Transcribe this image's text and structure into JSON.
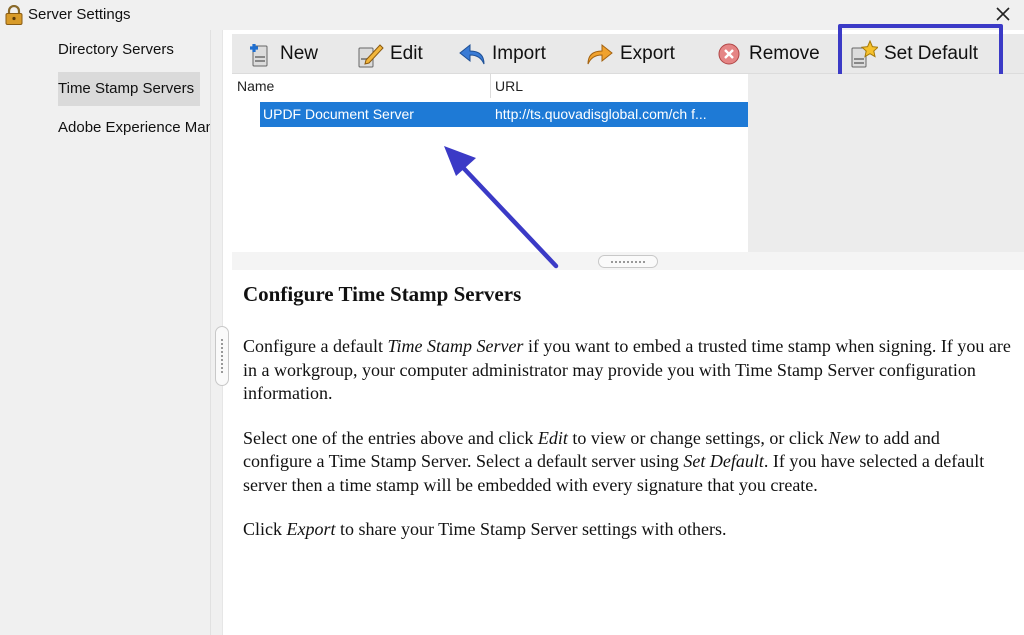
{
  "window": {
    "title": "Server Settings",
    "title_icon": "lock-icon",
    "close_icon": "close-icon"
  },
  "sidebar": {
    "items": [
      {
        "label": "Directory Servers",
        "selected": false
      },
      {
        "label": "Time Stamp Servers",
        "selected": true
      },
      {
        "label": "Adobe Experience Man",
        "selected": false
      }
    ]
  },
  "toolbar": {
    "buttons": [
      {
        "label": "New",
        "icon": "new-server-icon"
      },
      {
        "label": "Edit",
        "icon": "edit-pencil-icon"
      },
      {
        "label": "Import",
        "icon": "import-arrow-icon"
      },
      {
        "label": "Export",
        "icon": "export-arrow-icon"
      },
      {
        "label": "Remove",
        "icon": "remove-x-icon"
      },
      {
        "label": "Set Default",
        "icon": "set-default-star-icon"
      }
    ]
  },
  "table": {
    "columns": [
      "Name",
      "URL"
    ],
    "rows": [
      {
        "name": "UPDF Document Server",
        "url": "http://ts.quovadisglobal.com/ch f..."
      }
    ]
  },
  "description": {
    "heading": "Configure Time Stamp Servers",
    "p1_a": "Configure a default ",
    "p1_em": "Time Stamp Server",
    "p1_b": " if you want to embed a trusted time stamp when signing. If you are in a workgroup, your computer administrator may provide you with Time Stamp Server configuration information.",
    "p2_a": "Select one of the entries above and click ",
    "p2_em1": "Edit",
    "p2_b": " to view or change settings, or click ",
    "p2_em2": "New",
    "p2_c": " to add and configure a Time Stamp Server. Select a default server using ",
    "p2_em3": "Set Default",
    "p2_d": ". If you have selected a default server then a time stamp will be embedded with every signature that you create.",
    "p3_a": "Click ",
    "p3_em": "Export",
    "p3_b": " to share your Time Stamp Server settings with others."
  },
  "colors": {
    "selection": "#1e7ad6",
    "highlight_box": "#3b3ac6",
    "arrow": "#3b3ac6"
  }
}
